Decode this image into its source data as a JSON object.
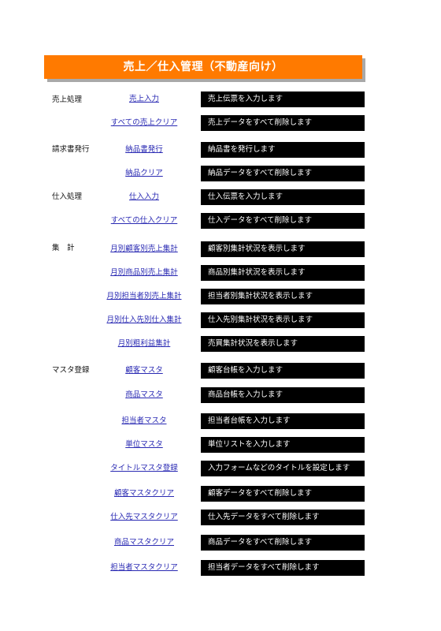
{
  "title": "売上／仕入管理（不動産向け）",
  "sections": {
    "sales": "売上処理",
    "invoice": "請求書発行",
    "purchase": "仕入処理",
    "totals": "集　計",
    "master": "マスタ登録"
  },
  "rows": [
    {
      "link": "売上入力",
      "desc": "売上伝票を入力します"
    },
    {
      "link": "すべての売上クリア",
      "desc": "売上データをすべて削除します"
    },
    {
      "link": "納品書発行",
      "desc": "納品書を発行します"
    },
    {
      "link": "納品クリア",
      "desc": "納品データをすべて削除します"
    },
    {
      "link": "仕入入力",
      "desc": "仕入伝票を入力します"
    },
    {
      "link": "すべての仕入クリア",
      "desc": "仕入データをすべて削除します"
    },
    {
      "link": "月別顧客別売上集計",
      "desc": "顧客別集計状況を表示します"
    },
    {
      "link": "月別商品別売上集計",
      "desc": "商品別集計状況を表示します"
    },
    {
      "link": "月別担当者別売上集計",
      "desc": "担当者別集計状況を表示します"
    },
    {
      "link": "月別仕入先別仕入集計",
      "desc": "仕入先別集計状況を表示します"
    },
    {
      "link": "月別粗利益集計",
      "desc": "売買集計状況を表示します"
    },
    {
      "link": "顧客マスタ",
      "desc": "顧客台帳を入力します"
    },
    {
      "link": "商品マスタ",
      "desc": "商品台帳を入力します"
    },
    {
      "link": "担当者マスタ",
      "desc": "担当者台帳を入力します"
    },
    {
      "link": "単位マスタ",
      "desc": "単位リストを入力します"
    },
    {
      "link": "タイトルマスタ登録",
      "desc": "入力フォームなどのタイトルを設定します"
    },
    {
      "link": "顧客マスタクリア",
      "desc": "顧客データをすべて削除します"
    },
    {
      "link": "仕入先マスタクリア",
      "desc": "仕入先データをすべて削除します"
    },
    {
      "link": "商品マスタクリア",
      "desc": "商品データをすべて削除します"
    },
    {
      "link": "担当者マスタクリア",
      "desc": "担当者データをすべて削除します"
    }
  ]
}
